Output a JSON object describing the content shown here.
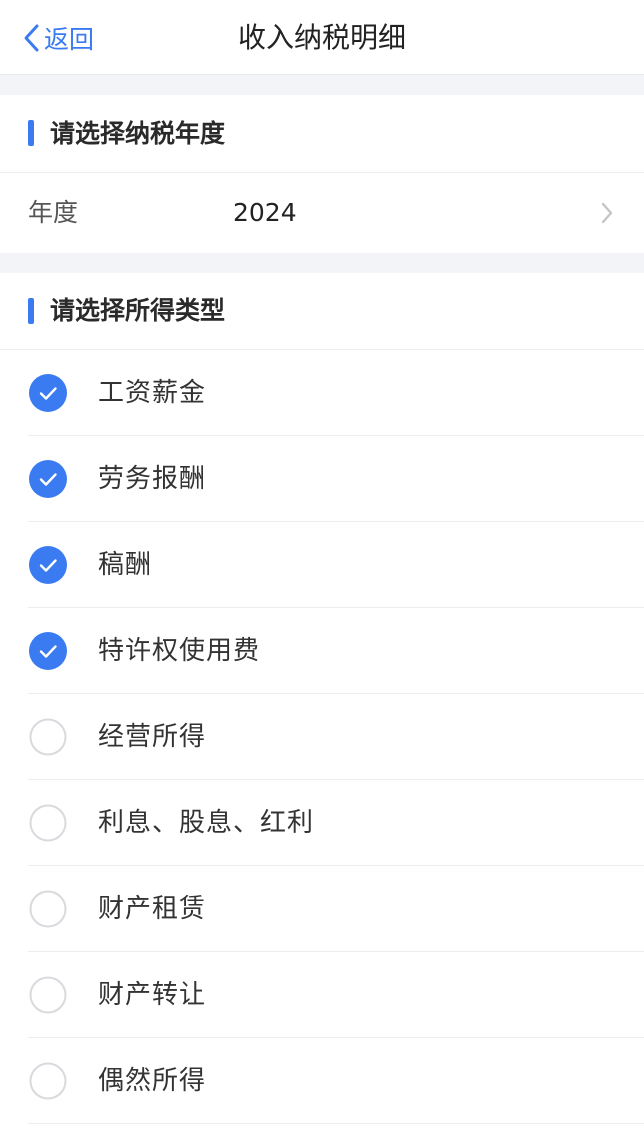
{
  "header": {
    "back_label": "返回",
    "title": "收入纳税明细"
  },
  "year_section": {
    "title": "请选择纳税年度",
    "row_label": "年度",
    "row_value": "2024"
  },
  "type_section": {
    "title": "请选择所得类型",
    "items": [
      {
        "label": "工资薪金",
        "checked": true
      },
      {
        "label": "劳务报酬",
        "checked": true
      },
      {
        "label": "稿酬",
        "checked": true
      },
      {
        "label": "特许权使用费",
        "checked": true
      },
      {
        "label": "经营所得",
        "checked": false
      },
      {
        "label": "利息、股息、红利",
        "checked": false
      },
      {
        "label": "财产租赁",
        "checked": false
      },
      {
        "label": "财产转让",
        "checked": false
      },
      {
        "label": "偶然所得",
        "checked": false
      }
    ]
  },
  "colors": {
    "accent": "#3a7bf2",
    "separator": "#f3f4f7",
    "unchecked_border": "#d9d9de"
  },
  "icons": {
    "back": "chevron-left-icon",
    "year_arrow": "chevron-right-icon",
    "checked": "checkmark-circle-icon",
    "unchecked": "empty-circle-icon"
  }
}
